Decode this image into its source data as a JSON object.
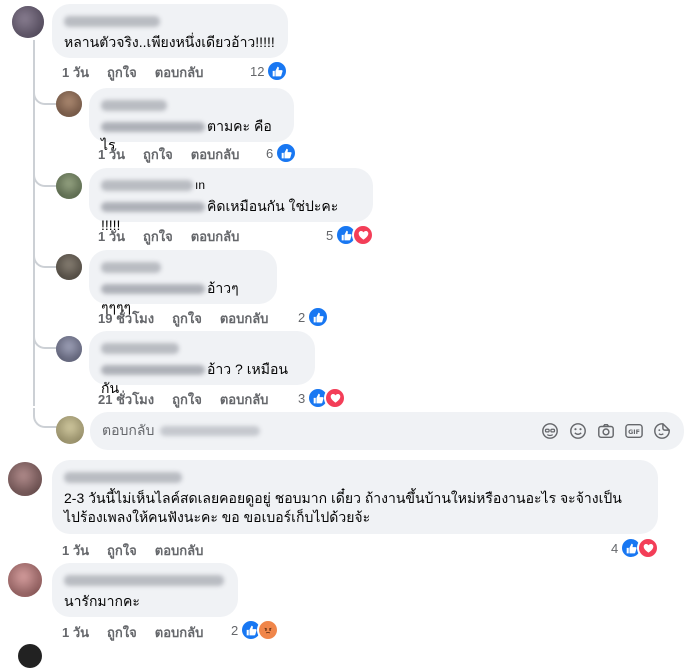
{
  "actions": {
    "like": "ถูกใจ",
    "reply": "ตอบกลับ"
  },
  "colors": {
    "like": "#1877f2",
    "love": "#f33e58",
    "angry": "#f0864a",
    "bubble": "#f0f2f5",
    "meta": "#65676b"
  },
  "comments": [
    {
      "text": "หลานตัวจริง..เพียงหนึ่งเดียวอ้าว!!!!!",
      "time": "1 วัน",
      "count": "12",
      "reactions": [
        "like"
      ]
    },
    {
      "text": "ตามคะ คือไร",
      "time": "1 วัน",
      "count": "6",
      "reactions": [
        "like"
      ]
    },
    {
      "name_fragment": "ın",
      "text": "คิดเหมือนกัน ใช่ปะคะ !!!!!",
      "time": "1 วัน",
      "count": "5",
      "reactions": [
        "like",
        "love"
      ]
    },
    {
      "text": "อ้าวๆๆๆๆๆ",
      "time": "19 ชั่วโมง",
      "count": "2",
      "reactions": [
        "like"
      ]
    },
    {
      "text": "อ้าว ? เหมือนกัน",
      "time": "21 ชั่วโมง",
      "count": "3",
      "reactions": [
        "like",
        "love"
      ]
    },
    {
      "text_line1": "2-3 วันนี้ไม่เห็นไลค์สดเลยคอยดูอยู่ ชอบมาก เดี๋ยว ถ้างานขึ้นบ้านใหม่หรืองานอะไร จะจ้างเป็น",
      "text_line2": "ไปร้องเพลงให้คนฟังนะคะ ขอ ขอเบอร์เก็บไปด้วยจ้ะ",
      "time": "1 วัน",
      "count": "4",
      "reactions": [
        "like",
        "love"
      ]
    },
    {
      "text": "นารักมากคะ",
      "time": "1 วัน",
      "count": "2",
      "reactions": [
        "like",
        "angry"
      ]
    }
  ],
  "reply_box": {
    "placeholder": "ตอบกลับ",
    "tools": [
      "sticker-face-icon",
      "emoji-icon",
      "camera-icon",
      "gif-icon",
      "sticker-icon"
    ]
  }
}
